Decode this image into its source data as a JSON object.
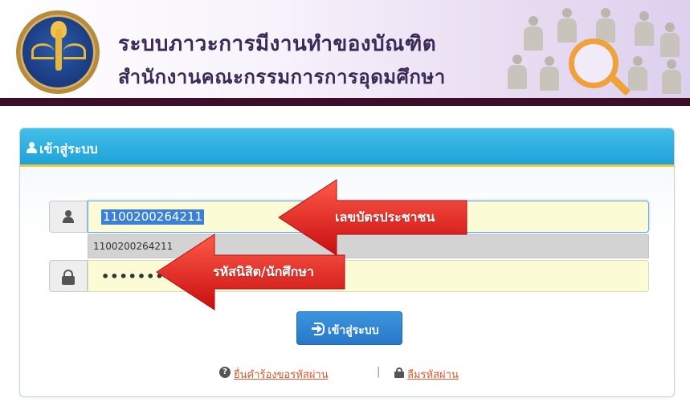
{
  "header": {
    "title_line1": "ระบบภาวะการมีงานทำของบัณฑิต",
    "title_line2": "สำนักงานคณะกรรมการการอุดมศึกษา",
    "logo_icon": "ohec-logo-icon",
    "graphic_icon": "people-search-icon"
  },
  "panel": {
    "title": "เข้าสู่ระบบ",
    "accent": "#1ea2d9"
  },
  "form": {
    "id_value": "1100200264211",
    "autocomplete_item": "1100200264211",
    "password_mask": "••••••••",
    "login_button": "เข้าสู่ระบบ"
  },
  "annotations": {
    "id_label": "เลขบัตรประชาชน",
    "password_label": "รหัสนิสิต/นักศึกษา",
    "color": "#e01c1c"
  },
  "links": {
    "request_password": "ยื่นคำร้องขอรหัสผ่าน",
    "separator": "|",
    "forgot_password": "ลืมรหัสผ่าน"
  }
}
